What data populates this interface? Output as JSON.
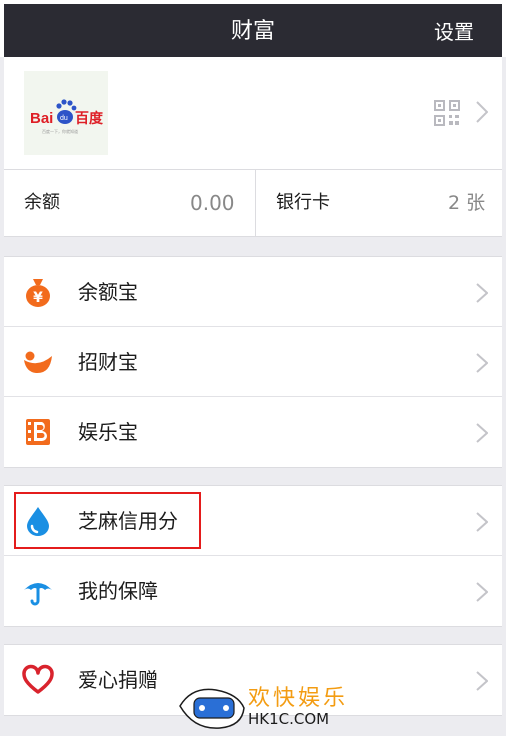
{
  "navbar": {
    "title": "财富",
    "settings_label": "设置"
  },
  "profile": {
    "logo_text": "Bai百度",
    "logo_caption": "百度一下，你就知道"
  },
  "balance": {
    "label": "余额",
    "value": "0.00"
  },
  "bank_card": {
    "label": "银行卡",
    "value": "2 张"
  },
  "group1": [
    {
      "label": "余额宝",
      "icon": "money-bag-icon",
      "color": "#f26b1d"
    },
    {
      "label": "招财宝",
      "icon": "fortune-bowl-icon",
      "color": "#f26b1d"
    },
    {
      "label": "娱乐宝",
      "icon": "film-b-icon",
      "color": "#f26b1d"
    }
  ],
  "group2": [
    {
      "label": "芝麻信用分",
      "icon": "water-drop-icon",
      "color": "#1a8fe3"
    },
    {
      "label": "我的保障",
      "icon": "umbrella-icon",
      "color": "#1a8fe3"
    }
  ],
  "group3": [
    {
      "label": "爱心捐赠",
      "icon": "heart-icon",
      "color": "#d9232d"
    }
  ],
  "watermark": {
    "cn": "欢快娱乐",
    "en": "HK1C.COM"
  },
  "colors": {
    "navbar": "#2b2b33",
    "highlight": "#e41c1c",
    "accent_orange": "#f26b1d",
    "accent_blue": "#1a8fe3"
  }
}
